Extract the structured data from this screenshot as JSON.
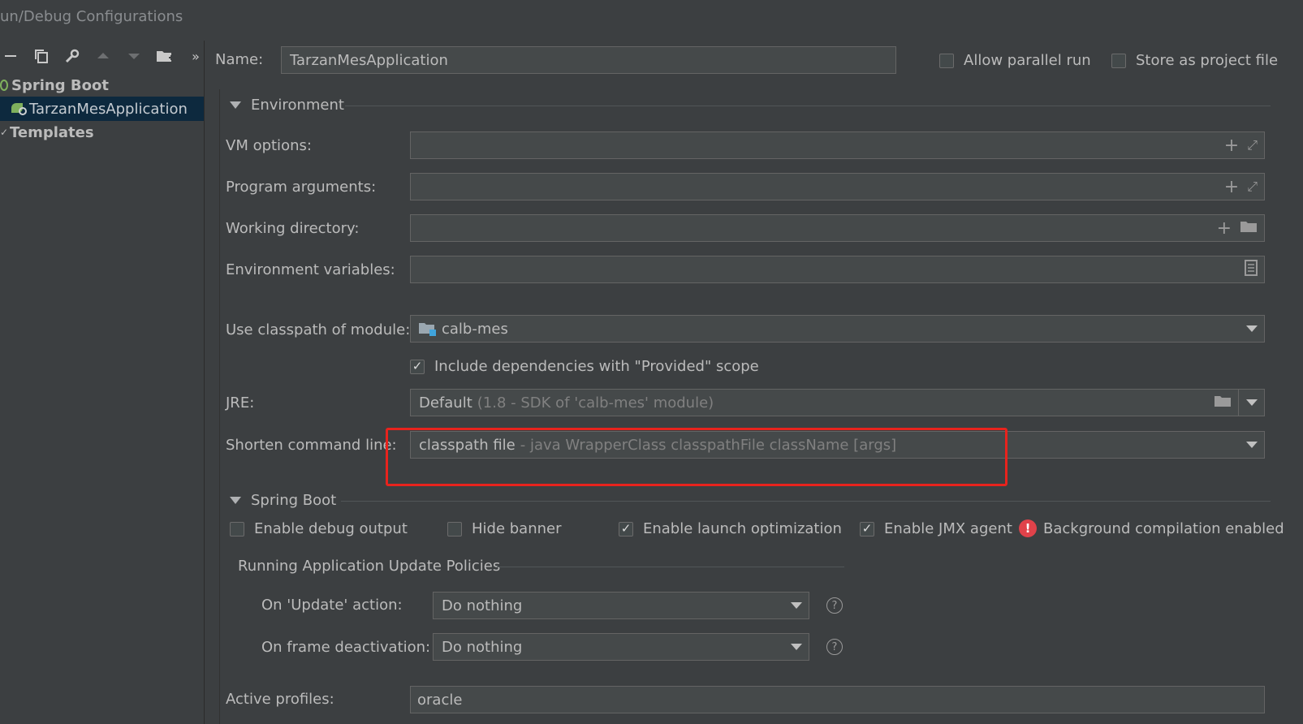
{
  "window": {
    "title": "un/Debug Configurations"
  },
  "toolbar": {
    "icons": [
      "minus-icon",
      "copy-icon",
      "wrench-icon",
      "arrow-up-icon",
      "arrow-down-icon",
      "new-folder-icon",
      "more-icon"
    ]
  },
  "tree": {
    "spring_boot": "Spring Boot",
    "app": "TarzanMesApplication",
    "templates": "Templates"
  },
  "header": {
    "name_label": "Name:",
    "name_value": "TarzanMesApplication",
    "allow_parallel": "Allow parallel run",
    "store_project": "Store as project file"
  },
  "environment": {
    "section": "Environment",
    "vm_label": "VM options:",
    "vm_value": "",
    "prog_label": "Program arguments:",
    "prog_value": "",
    "wd_label": "Working directory:",
    "wd_value": "",
    "env_label": "Environment variables:",
    "env_value": ""
  },
  "module": {
    "label": "Use classpath of module:",
    "value": "calb-mes",
    "include_deps": "Include dependencies with \"Provided\" scope"
  },
  "jre": {
    "label": "JRE:",
    "value": "Default",
    "hint": "(1.8 - SDK of 'calb-mes' module)"
  },
  "shorten": {
    "label": "Shorten command line:",
    "value": "classpath file",
    "hint": "- java WrapperClass classpathFile className [args]"
  },
  "spring": {
    "section": "Spring Boot",
    "debug_output": "Enable debug output",
    "hide_banner": "Hide banner",
    "launch_opt": "Enable launch optimization",
    "jmx": "Enable JMX agent",
    "bg_compile": "Background compilation enabled"
  },
  "policies": {
    "title": "Running Application Update Policies",
    "update_label": "On 'Update' action:",
    "update_value": "Do nothing",
    "frame_label": "On frame deactivation:",
    "frame_value": "Do nothing"
  },
  "profiles": {
    "label": "Active profiles:",
    "value": "oracle"
  },
  "colors": {
    "highlight_box": "#e8231d",
    "selection": "#0d293e"
  }
}
